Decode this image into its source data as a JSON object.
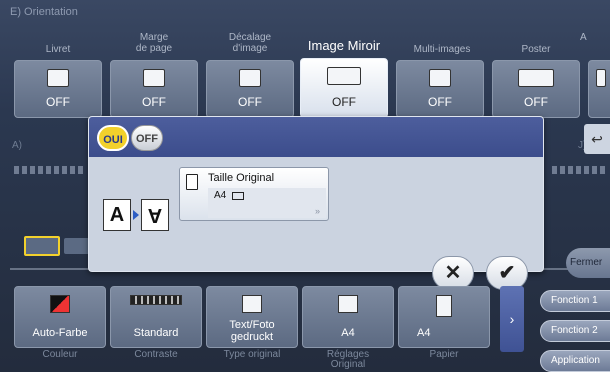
{
  "header": {
    "caption": "E)  Orientation"
  },
  "top_tabs": [
    {
      "label": "Livret",
      "value": "OFF",
      "icon": "booklet-icon"
    },
    {
      "label": "Marge\nde page",
      "value": "OFF",
      "icon": "page-margin-icon"
    },
    {
      "label": "Décalage\nd'image",
      "value": "OFF",
      "icon": "image-shift-icon"
    },
    {
      "label": "Image Miroir",
      "value": "OFF",
      "icon": "mirror-image-icon",
      "selected": true
    },
    {
      "label": "Multi-images",
      "value": "OFF",
      "icon": "multi-image-icon"
    },
    {
      "label": "Poster",
      "value": "OFF",
      "icon": "poster-icon"
    },
    {
      "label": "A",
      "value": "",
      "icon": "more-icon"
    }
  ],
  "middle": {
    "left_label": "A)",
    "right_label": "J)"
  },
  "dialog": {
    "on_label": "OUI",
    "off_label": "OFF",
    "mirror_left": "A",
    "mirror_right": "A",
    "original_title": "Taille Original",
    "original_value": "A4",
    "chevron": "»"
  },
  "actions": {
    "cancel_glyph": "✕",
    "ok_glyph": "✔"
  },
  "bottom_buttons": [
    {
      "value": "Auto-Farbe",
      "label": "Couleur",
      "icon": "color-icon"
    },
    {
      "value": "Standard",
      "label": "Contraste",
      "icon": "contrast-icon"
    },
    {
      "value": "Text/Foto\ngedruckt",
      "label": "Type original",
      "icon": "text-photo-icon"
    },
    {
      "value": "A4",
      "label": "Réglages\nOriginal",
      "icon": "original-settings-icon"
    },
    {
      "value": "A4",
      "label": "Papier",
      "icon": "paper-icon"
    }
  ],
  "side": {
    "nav_glyph": "›",
    "fermer": "Fermer",
    "fonction1": "Fonction 1",
    "fonction2": "Fonction 2",
    "application": "Application",
    "back_glyph": "↩"
  },
  "colors": {
    "toggle_on": "#f2d12c",
    "dialog_header": "#4d5e9d",
    "mirror_arrow": "#2b5cc4"
  }
}
